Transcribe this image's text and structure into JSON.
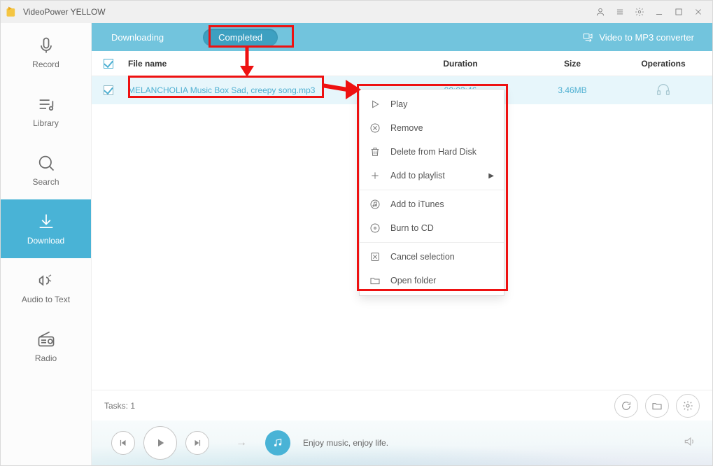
{
  "app": {
    "title": "VideoPower YELLOW"
  },
  "titlebar_icons": [
    "user",
    "list",
    "gear",
    "min",
    "max",
    "close"
  ],
  "sidebar": {
    "items": [
      {
        "id": "record",
        "label": "Record"
      },
      {
        "id": "library",
        "label": "Library"
      },
      {
        "id": "search",
        "label": "Search"
      },
      {
        "id": "download",
        "label": "Download"
      },
      {
        "id": "audio-to-text",
        "label": "Audio to Text"
      },
      {
        "id": "radio",
        "label": "Radio"
      }
    ],
    "selected": "download"
  },
  "tabs": {
    "downloading": "Downloading",
    "completed": "Completed",
    "active": "completed",
    "mp3converter": "Video to MP3 converter"
  },
  "columns": {
    "filename": "File name",
    "duration": "Duration",
    "size": "Size",
    "operations": "Operations"
  },
  "rows": [
    {
      "filename": "MELANCHOLIA Music Box Sad, creepy song.mp3",
      "duration": "00:03:46",
      "size": "3.46MB"
    }
  ],
  "footer": {
    "tasks_label": "Tasks: 1"
  },
  "player": {
    "message": "Enjoy music, enjoy life."
  },
  "context_menu": {
    "items": [
      {
        "id": "play",
        "label": "Play"
      },
      {
        "id": "remove",
        "label": "Remove"
      },
      {
        "id": "delete-disk",
        "label": "Delete from Hard Disk"
      },
      {
        "id": "add-playlist",
        "label": "Add to playlist",
        "submenu": true
      },
      {
        "id": "add-itunes",
        "label": "Add to iTunes"
      },
      {
        "id": "burn-cd",
        "label": "Burn to CD"
      },
      {
        "id": "cancel-selection",
        "label": "Cancel selection"
      },
      {
        "id": "open-folder",
        "label": "Open folder"
      }
    ]
  }
}
